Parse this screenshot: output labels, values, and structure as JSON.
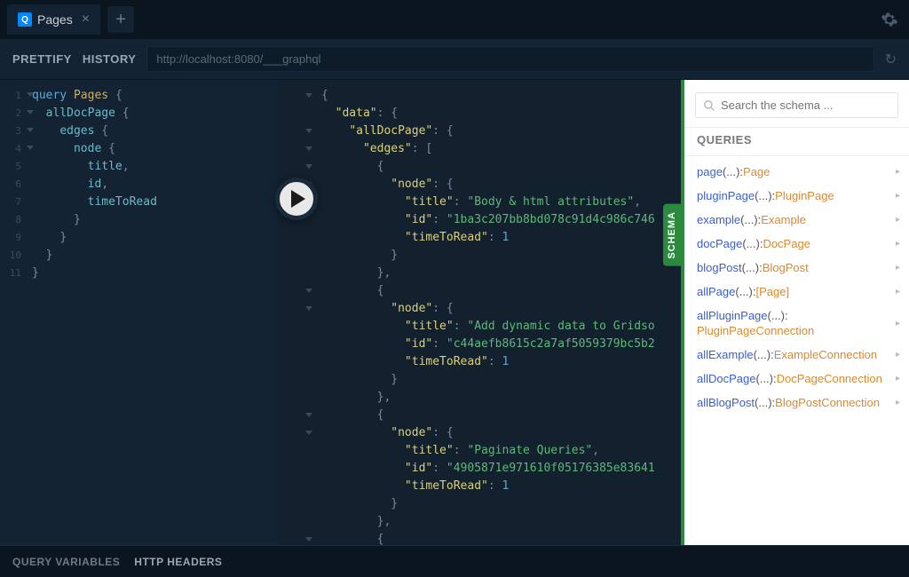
{
  "tab": {
    "icon": "Q",
    "title": "Pages"
  },
  "toolbar": {
    "prettify": "PRETTIFY",
    "history": "HISTORY",
    "url": "http://localhost:8080/___graphql"
  },
  "editor": {
    "lines": [
      {
        "num": "1",
        "fold": true,
        "tokens": [
          [
            "kw",
            "query "
          ],
          [
            "name",
            "Pages "
          ],
          [
            "punct",
            "{"
          ]
        ]
      },
      {
        "num": "2",
        "fold": true,
        "tokens": [
          [
            "",
            "  "
          ],
          [
            "field",
            "allDocPage "
          ],
          [
            "punct",
            "{"
          ]
        ]
      },
      {
        "num": "3",
        "fold": true,
        "tokens": [
          [
            "",
            "    "
          ],
          [
            "field",
            "edges "
          ],
          [
            "punct",
            "{"
          ]
        ]
      },
      {
        "num": "4",
        "fold": true,
        "tokens": [
          [
            "",
            "      "
          ],
          [
            "field",
            "node "
          ],
          [
            "punct",
            "{"
          ]
        ]
      },
      {
        "num": "5",
        "tokens": [
          [
            "",
            "        "
          ],
          [
            "field",
            "title"
          ],
          [
            "punct",
            ","
          ]
        ]
      },
      {
        "num": "6",
        "tokens": [
          [
            "",
            "        "
          ],
          [
            "field",
            "id"
          ],
          [
            "punct",
            ","
          ]
        ]
      },
      {
        "num": "7",
        "tokens": [
          [
            "",
            "        "
          ],
          [
            "field",
            "timeToRead"
          ]
        ]
      },
      {
        "num": "8",
        "tokens": [
          [
            "",
            "      "
          ],
          [
            "punct",
            "}"
          ]
        ]
      },
      {
        "num": "9",
        "tokens": [
          [
            "",
            "    "
          ],
          [
            "punct",
            "}"
          ]
        ]
      },
      {
        "num": "10",
        "tokens": [
          [
            "",
            "  "
          ],
          [
            "punct",
            "}"
          ]
        ]
      },
      {
        "num": "11",
        "tokens": [
          [
            "punct",
            "}"
          ]
        ]
      }
    ]
  },
  "result": {
    "lines": [
      {
        "fold": true,
        "tokens": [
          [
            "punct",
            "{"
          ]
        ]
      },
      {
        "tokens": [
          [
            "",
            "  "
          ],
          [
            "str",
            "\"data\""
          ],
          [
            "punct",
            ": {"
          ]
        ]
      },
      {
        "fold": true,
        "tokens": [
          [
            "",
            "    "
          ],
          [
            "str",
            "\"allDocPage\""
          ],
          [
            "punct",
            ": {"
          ]
        ]
      },
      {
        "fold": true,
        "tokens": [
          [
            "",
            "      "
          ],
          [
            "str",
            "\"edges\""
          ],
          [
            "punct",
            ": ["
          ]
        ]
      },
      {
        "fold": true,
        "tokens": [
          [
            "",
            "        "
          ],
          [
            "punct",
            "{"
          ]
        ]
      },
      {
        "fold": true,
        "tokens": [
          [
            "",
            "          "
          ],
          [
            "str",
            "\"node\""
          ],
          [
            "punct",
            ": {"
          ]
        ]
      },
      {
        "tokens": [
          [
            "",
            "            "
          ],
          [
            "str",
            "\"title\""
          ],
          [
            "punct",
            ": "
          ],
          [
            "strval",
            "\"Body & html attributes\""
          ],
          [
            "punct",
            ","
          ]
        ]
      },
      {
        "tokens": [
          [
            "",
            "            "
          ],
          [
            "str",
            "\"id\""
          ],
          [
            "punct",
            ": "
          ],
          [
            "strval",
            "\"1ba3c207bb8bd078c91d4c986c746"
          ]
        ]
      },
      {
        "tokens": [
          [
            "",
            "            "
          ],
          [
            "str",
            "\"timeToRead\""
          ],
          [
            "punct",
            ": "
          ],
          [
            "num",
            "1"
          ]
        ]
      },
      {
        "tokens": [
          [
            "",
            "          "
          ],
          [
            "punct",
            "}"
          ]
        ]
      },
      {
        "tokens": [
          [
            "",
            "        "
          ],
          [
            "punct",
            "},"
          ]
        ]
      },
      {
        "fold": true,
        "tokens": [
          [
            "",
            "        "
          ],
          [
            "punct",
            "{"
          ]
        ]
      },
      {
        "fold": true,
        "tokens": [
          [
            "",
            "          "
          ],
          [
            "str",
            "\"node\""
          ],
          [
            "punct",
            ": {"
          ]
        ]
      },
      {
        "tokens": [
          [
            "",
            "            "
          ],
          [
            "str",
            "\"title\""
          ],
          [
            "punct",
            ": "
          ],
          [
            "strval",
            "\"Add dynamic data to Gridso"
          ]
        ]
      },
      {
        "tokens": [
          [
            "",
            "            "
          ],
          [
            "str",
            "\"id\""
          ],
          [
            "punct",
            ": "
          ],
          [
            "strval",
            "\"c44aefb8615c2a7af5059379bc5b2"
          ]
        ]
      },
      {
        "tokens": [
          [
            "",
            "            "
          ],
          [
            "str",
            "\"timeToRead\""
          ],
          [
            "punct",
            ": "
          ],
          [
            "num",
            "1"
          ]
        ]
      },
      {
        "tokens": [
          [
            "",
            "          "
          ],
          [
            "punct",
            "}"
          ]
        ]
      },
      {
        "tokens": [
          [
            "",
            "        "
          ],
          [
            "punct",
            "},"
          ]
        ]
      },
      {
        "fold": true,
        "tokens": [
          [
            "",
            "        "
          ],
          [
            "punct",
            "{"
          ]
        ]
      },
      {
        "fold": true,
        "tokens": [
          [
            "",
            "          "
          ],
          [
            "str",
            "\"node\""
          ],
          [
            "punct",
            ": {"
          ]
        ]
      },
      {
        "tokens": [
          [
            "",
            "            "
          ],
          [
            "str",
            "\"title\""
          ],
          [
            "punct",
            ": "
          ],
          [
            "strval",
            "\"Paginate Queries\""
          ],
          [
            "punct",
            ","
          ]
        ]
      },
      {
        "tokens": [
          [
            "",
            "            "
          ],
          [
            "str",
            "\"id\""
          ],
          [
            "punct",
            ": "
          ],
          [
            "strval",
            "\"4905871e971610f05176385e83641"
          ]
        ]
      },
      {
        "tokens": [
          [
            "",
            "            "
          ],
          [
            "str",
            "\"timeToRead\""
          ],
          [
            "punct",
            ": "
          ],
          [
            "num",
            "1"
          ]
        ]
      },
      {
        "tokens": [
          [
            "",
            "          "
          ],
          [
            "punct",
            "}"
          ]
        ]
      },
      {
        "tokens": [
          [
            "",
            "        "
          ],
          [
            "punct",
            "},"
          ]
        ]
      },
      {
        "fold": true,
        "tokens": [
          [
            "",
            "        "
          ],
          [
            "punct",
            "{"
          ]
        ]
      }
    ]
  },
  "schema": {
    "tab_label": "SCHEMA",
    "search_placeholder": "Search the schema ...",
    "section": "QUERIES",
    "items": [
      {
        "name": "page",
        "args": "(...): ",
        "type": "Page"
      },
      {
        "name": "pluginPage",
        "args": "(...): ",
        "type": "PluginPage"
      },
      {
        "name": "example",
        "args": "(...): ",
        "type": "Example"
      },
      {
        "name": "docPage",
        "args": "(...): ",
        "type": "DocPage"
      },
      {
        "name": "blogPost",
        "args": "(...): ",
        "type": "BlogPost"
      },
      {
        "name": "allPage",
        "args": "(...): ",
        "type": "[Page]"
      },
      {
        "name": "allPluginPage",
        "args": "(...): ",
        "type": "PluginPageConnection",
        "wrap": true
      },
      {
        "name": "allExample",
        "args": "(...): ",
        "type": "ExampleConnection"
      },
      {
        "name": "allDocPage",
        "args": "(...): ",
        "type": "DocPageConnection"
      },
      {
        "name": "allBlogPost",
        "args": "(...): ",
        "type": "BlogPostConnection"
      }
    ]
  },
  "bottom": {
    "vars": "QUERY VARIABLES",
    "headers": "HTTP HEADERS"
  }
}
